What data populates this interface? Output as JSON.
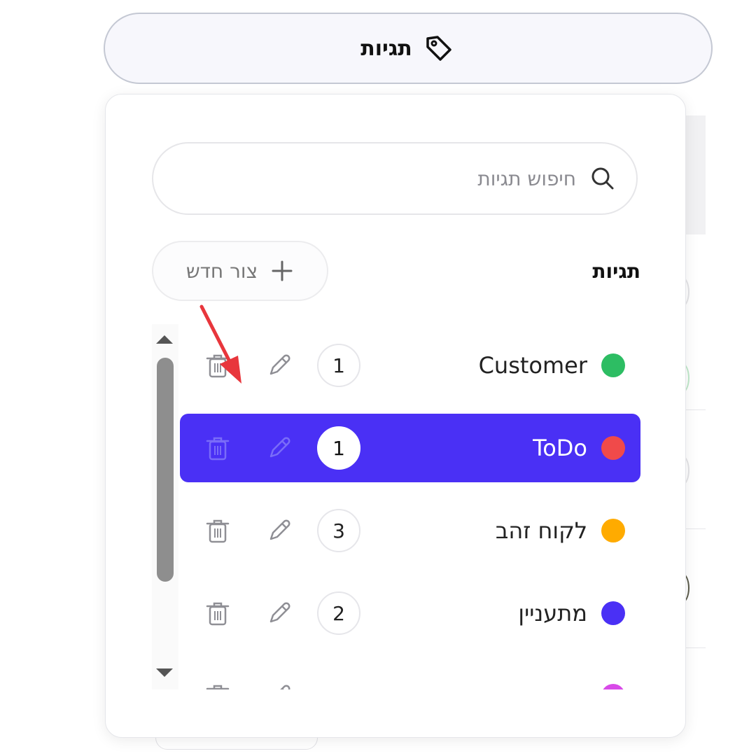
{
  "toggle": {
    "label": "תגיות",
    "icon": "tag-icon"
  },
  "popover": {
    "search": {
      "placeholder": "חיפוש תגיות",
      "value": "",
      "icon": "search-icon"
    },
    "section_title": "תגיות",
    "new_button": {
      "label": "צור חדש",
      "icon": "plus-icon"
    },
    "tags": [
      {
        "name": "Customer",
        "count": "1",
        "color": "#2dbd63",
        "selected": false
      },
      {
        "name": "ToDo",
        "count": "1",
        "color": "#f04a4a",
        "selected": true
      },
      {
        "name": "לקוח זהב",
        "count": "3",
        "color": "#ffab00",
        "selected": false
      },
      {
        "name": "מתעניין",
        "count": "2",
        "color": "#4a30f5",
        "selected": false
      },
      {
        "name": "",
        "count": "",
        "color": "#d84ae8",
        "selected": false
      }
    ]
  },
  "colors": {
    "accent": "#4a30f5",
    "annotation_arrow": "#e8363c"
  }
}
